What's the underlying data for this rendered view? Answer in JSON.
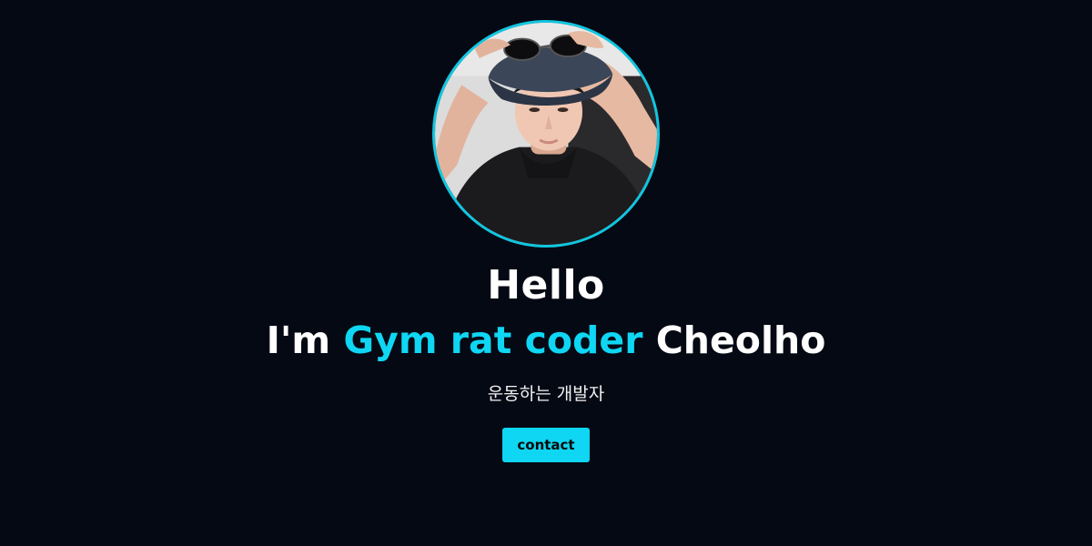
{
  "hero": {
    "greeting": "Hello",
    "intro_prefix": "I'm ",
    "intro_highlight": "Gym rat coder",
    "intro_suffix": " Cheolho",
    "subtitle": "운동하는 개발자",
    "contact_label": "contact"
  },
  "avatar": {
    "icon": "profile-photo"
  },
  "colors": {
    "background": "#050914",
    "accent": "#0fd6f2",
    "text": "#ffffff"
  }
}
